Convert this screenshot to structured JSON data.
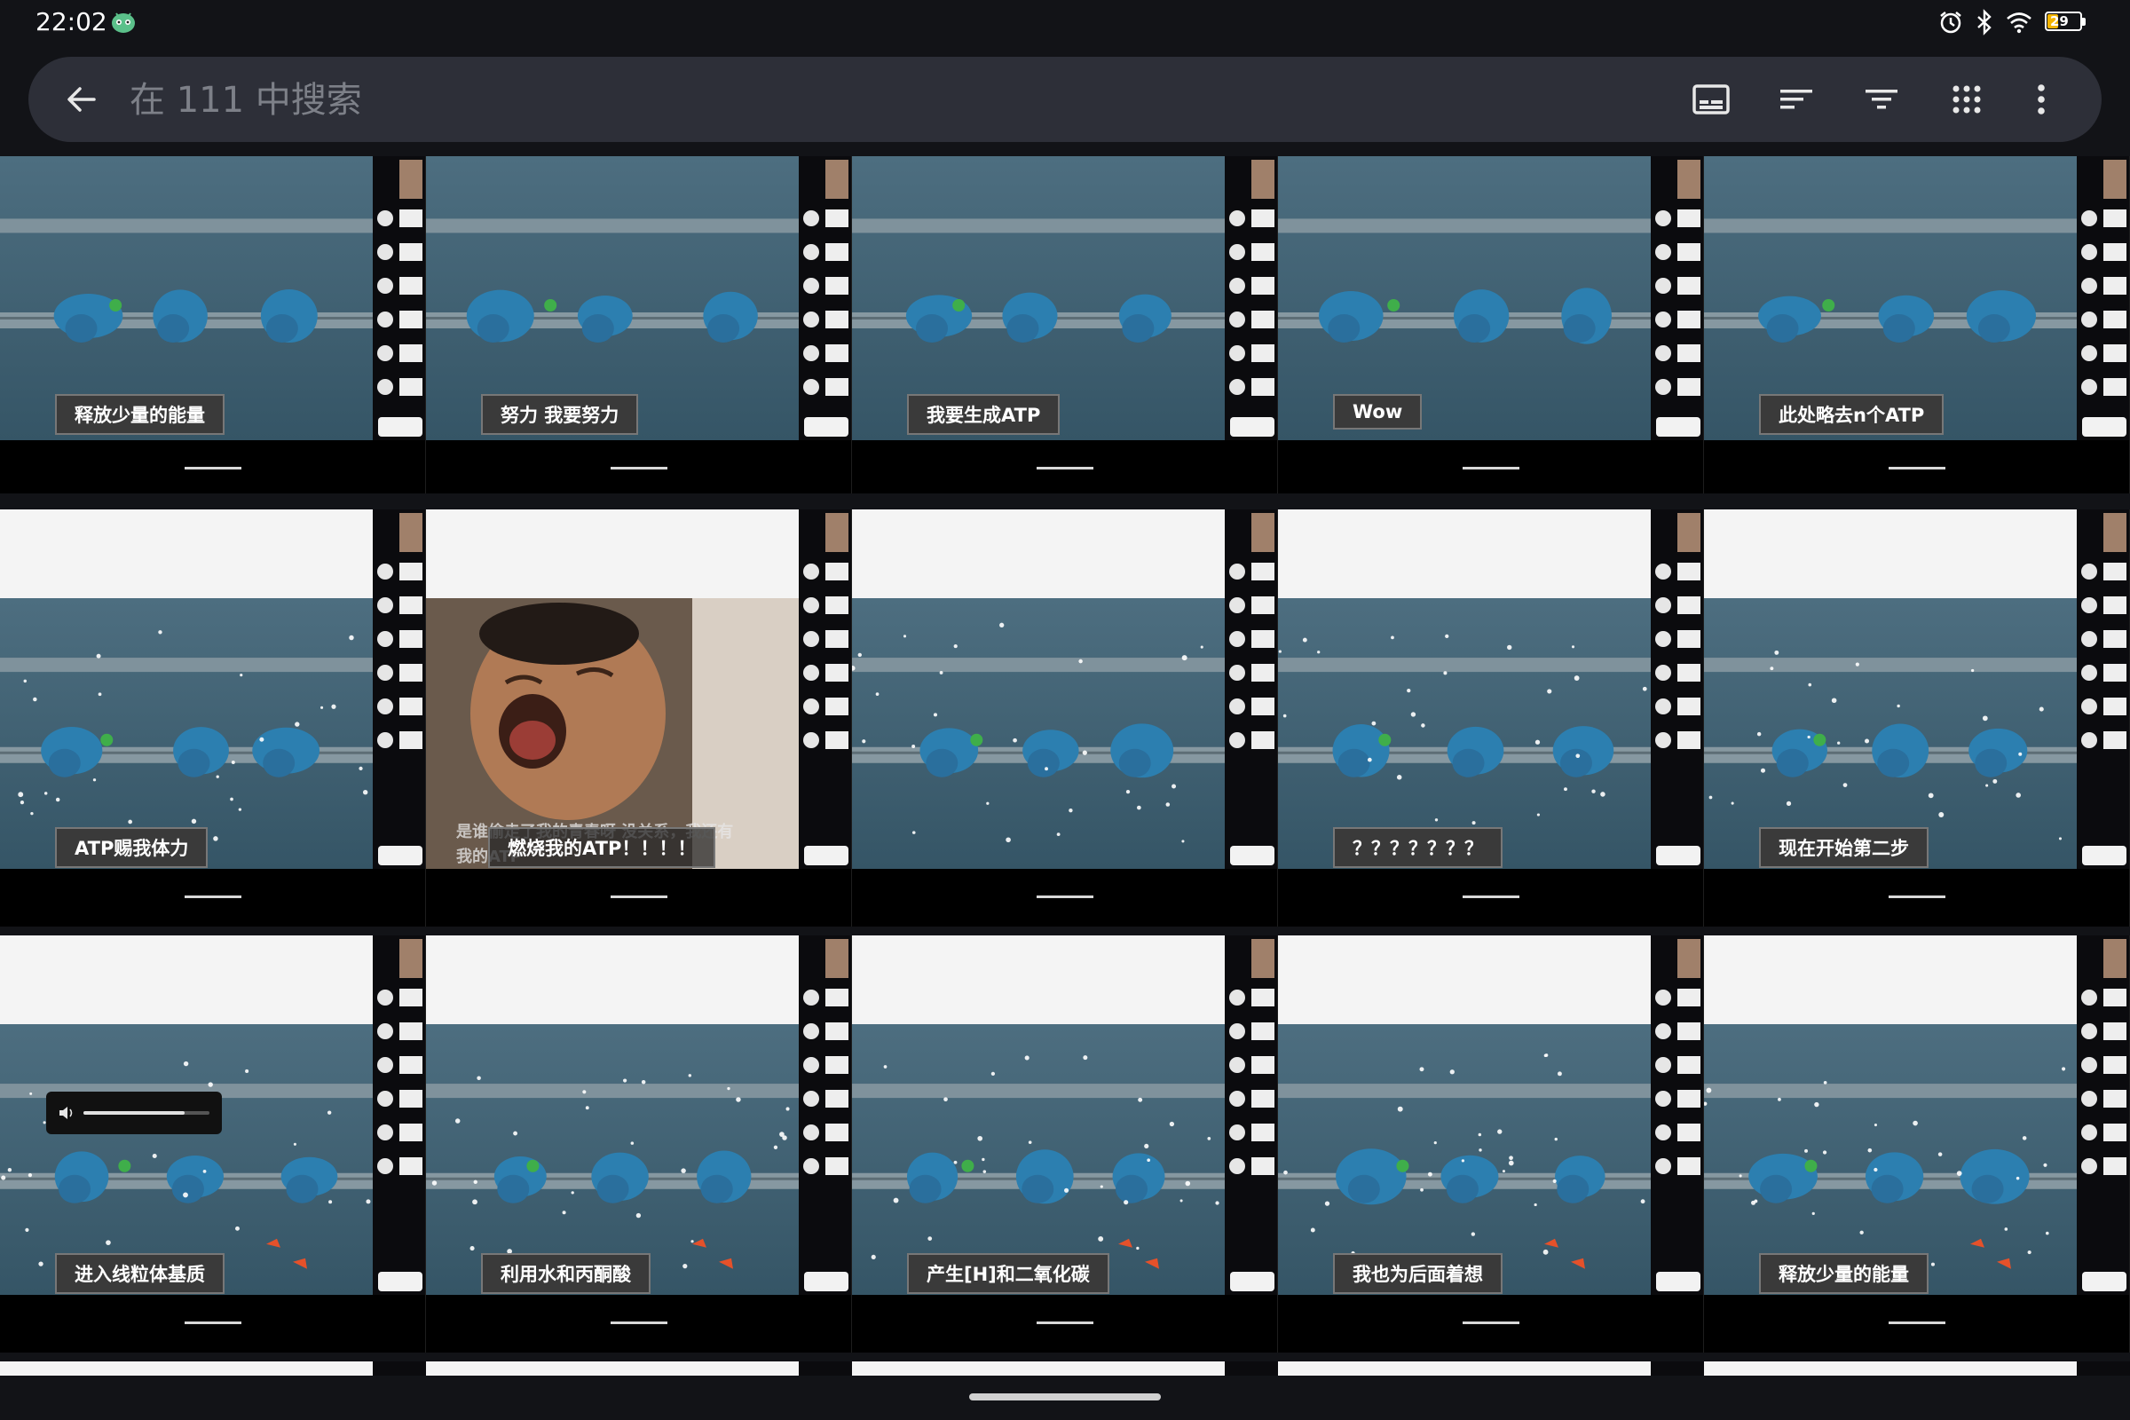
{
  "status_bar": {
    "time": "22:02",
    "app_icon": "android-robot-icon",
    "icons": [
      "alarm-icon",
      "bluetooth-icon",
      "wifi-icon"
    ],
    "battery_level": "29",
    "battery_color": "#f2b400"
  },
  "search": {
    "placeholder": "在 111 中搜索",
    "value": ""
  },
  "toolbar": {
    "buttons": [
      "subtitles-icon",
      "sort-icon",
      "filter-icon",
      "grid-view-icon",
      "more-vert-icon"
    ]
  },
  "thumbnails": [
    {
      "caption": "释放少量的能量",
      "type": "membrane"
    },
    {
      "caption": "努力 我要努力",
      "type": "membrane"
    },
    {
      "caption": "我要生成ATP",
      "type": "membrane"
    },
    {
      "caption": "Wow",
      "type": "membrane"
    },
    {
      "caption": "此处略去n个ATP",
      "type": "membrane"
    },
    {
      "caption": "ATP赐我体力",
      "type": "membrane"
    },
    {
      "caption": "燃烧我的ATP！！！！",
      "type": "meme",
      "subtitle": "是谁偷走了我的青春呀 没关系，我还有我的ATP"
    },
    {
      "caption": "",
      "type": "membrane"
    },
    {
      "caption": "？？？？？？？",
      "type": "membrane"
    },
    {
      "caption": "现在开始第二步",
      "type": "membrane"
    },
    {
      "caption": "进入线粒体基质",
      "type": "membrane"
    },
    {
      "caption": "利用水和丙酮酸",
      "type": "membrane"
    },
    {
      "caption": "产生[H]和二氧化碳",
      "type": "membrane"
    },
    {
      "caption": "我也为后面着想",
      "type": "membrane"
    },
    {
      "caption": "释放少量的能量",
      "type": "membrane"
    }
  ],
  "volume": {
    "icon": "volume-icon",
    "level": 0.8
  }
}
